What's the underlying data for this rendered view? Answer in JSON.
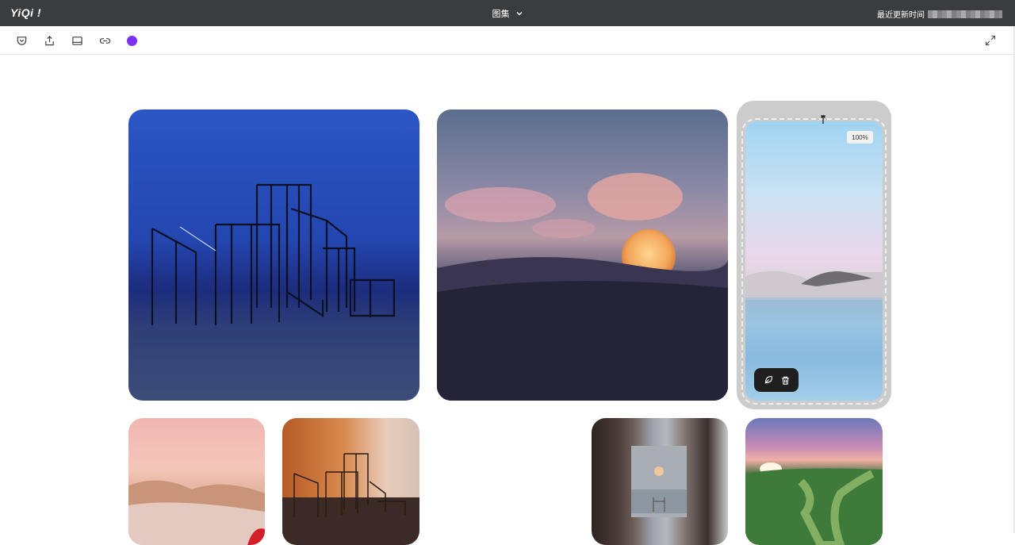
{
  "app": {
    "logo": "YiQi !"
  },
  "header": {
    "title": "图集",
    "updated_label": "最近更新时间"
  },
  "toolbar": {
    "icons": [
      "pocket-icon",
      "share-icon",
      "layout-icon",
      "link-icon",
      "color-swatch",
      "expand-icon"
    ],
    "accent_color": "#7b2ff7"
  },
  "gallery": {
    "selected": {
      "zoom": "100%"
    },
    "images": [
      {
        "name": "blue-wire-sculpture"
      },
      {
        "name": "desert-moon-sunset"
      },
      {
        "name": "pastel-lake-landscape"
      },
      {
        "name": "pink-dunes"
      },
      {
        "name": "orange-wire-sculpture"
      },
      {
        "name": "corridor-sunset"
      },
      {
        "name": "green-hills-sunrise"
      }
    ]
  }
}
